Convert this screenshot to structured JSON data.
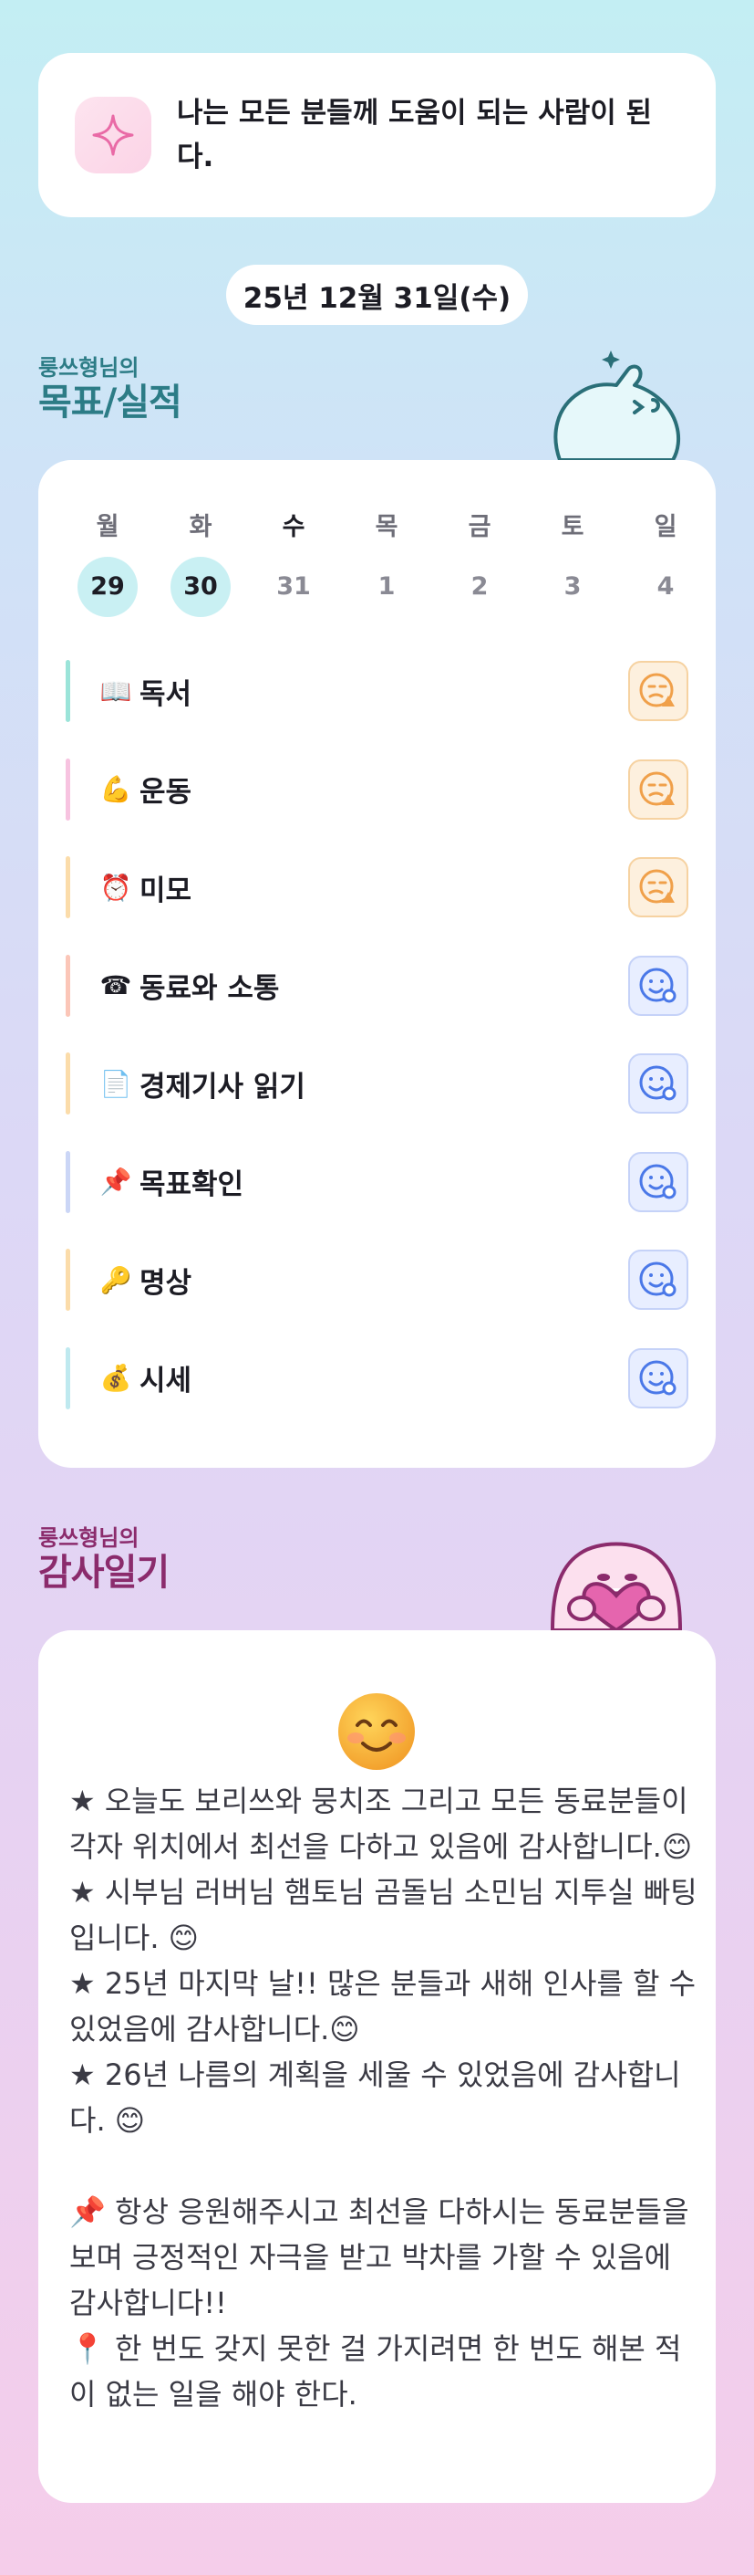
{
  "motto": {
    "icon": "sparkle-icon",
    "text": "나는 모든 분들께 도움이 되는 사람이 된다."
  },
  "date": "25년 12월 31일(수)",
  "goals_section": {
    "sub": "룽쓰형님의",
    "main": "목표/실적"
  },
  "week": [
    {
      "name": "월",
      "date": "29",
      "state": "done"
    },
    {
      "name": "화",
      "date": "30",
      "state": "done"
    },
    {
      "name": "수",
      "date": "31",
      "state": "today"
    },
    {
      "name": "목",
      "date": "1",
      "state": "future"
    },
    {
      "name": "금",
      "date": "2",
      "state": "future"
    },
    {
      "name": "토",
      "date": "3",
      "state": "future"
    },
    {
      "name": "일",
      "date": "4",
      "state": "future"
    }
  ],
  "goals": [
    {
      "emoji": "📖",
      "label": "독서",
      "bar": "#9be4d9",
      "status": "warn"
    },
    {
      "emoji": "💪",
      "label": "운동",
      "bar": "#f7c3e0",
      "status": "warn"
    },
    {
      "emoji": "⏰",
      "label": "미모",
      "bar": "#fbdcaa",
      "status": "warn"
    },
    {
      "emoji": "☎",
      "label": "동료와 소통",
      "bar": "#fbc6b8",
      "status": "ok"
    },
    {
      "emoji": "📄",
      "label": "경제기사 읽기",
      "bar": "#fbdcaa",
      "status": "ok"
    },
    {
      "emoji": "📌",
      "label": "목표확인",
      "bar": "#cbd6f6",
      "status": "ok"
    },
    {
      "emoji": "🔑",
      "label": "명상",
      "bar": "#fbdcaa",
      "status": "ok"
    },
    {
      "emoji": "💰",
      "label": "시세",
      "bar": "#bfe9ef",
      "status": "ok"
    }
  ],
  "gratitude_section": {
    "sub": "룽쓰형님의",
    "main": "감사일기"
  },
  "gratitude": {
    "icon": "smiley-icon",
    "text": "★ 오늘도 보리쓰와 뭉치조 그리고 모든 동료분들이 각자 위치에서 최선을 다하고 있음에 감사합니다.😊\n★ 시부님 러버님 햄토님 곰돌님 소민님 지투실 빠팅입니다. 😊\n★ 25년 마지막 날!! 많은 분들과 새해 인사를 할 수 있었음에 감사합니다.😊\n★ 26년 나름의 계획을 세울 수 있었음에 감사합니다. 😊\n\n📌 항상 응원해주시고 최선을 다하시는 동료분들을 보며 긍정적인 자극을 받고 박차를 가할 수 있음에 감사합니다!!\n📍 한 번도 갖지 못한 걸 가지려면 한 번도 해본 적이 없는 일을 해야 한다."
  },
  "colors": {
    "accent_teal": "#2c7c86",
    "accent_plum": "#8b2b6c",
    "warn": "#f0a04a",
    "ok": "#4a78e8"
  }
}
